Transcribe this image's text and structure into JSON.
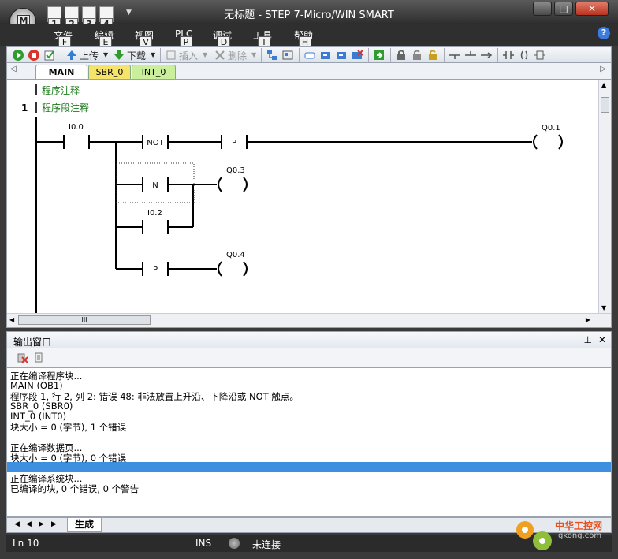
{
  "titlebar": {
    "title": "无标题 - STEP 7-Micro/WIN SMART",
    "app_key": "M",
    "quick_keys": [
      "1",
      "2",
      "3",
      "4"
    ],
    "caption_buttons": [
      "–",
      "□",
      "✕"
    ]
  },
  "menu": [
    {
      "label": "文件",
      "key": "F"
    },
    {
      "label": "编辑",
      "key": "E"
    },
    {
      "label": "视图",
      "key": "V"
    },
    {
      "label": "PLC",
      "key": "P"
    },
    {
      "label": "调试",
      "key": "D"
    },
    {
      "label": "工具",
      "key": "T"
    },
    {
      "label": "帮助",
      "key": "H"
    }
  ],
  "help_icon": "?",
  "toolbar": {
    "upload": "上传",
    "download": "下载",
    "insert": "插入",
    "delete": "删除"
  },
  "tabs": [
    "MAIN",
    "SBR_0",
    "INT_0"
  ],
  "editor": {
    "program_comment": "程序注释",
    "network_number": "1",
    "network_comment": "程序段注释",
    "contacts": {
      "i00": "I0.0",
      "not": "NOT",
      "p1": "P",
      "n": "N",
      "i02": "I0.2",
      "p2": "P"
    },
    "coils": {
      "q01": "Q0.1",
      "q03": "Q0.3",
      "q04": "Q0.4"
    },
    "hscroll_grip": "III"
  },
  "output": {
    "title": "输出窗口",
    "lines": [
      "正在编译程序块...",
      "MAIN (OB1)",
      "程序段 1, 行 2, 列 2: 错误 48: 非法放置上升沿、下降沿或 NOT 触点。",
      "SBR_0 (SBR0)",
      "INT_0 (INT0)",
      "块大小 = 0 (字节), 1 个错误",
      "",
      "正在编译数据页...",
      "块大小 = 0 (字节), 0 个错误",
      "",
      "正在编译系统块...",
      "已编译的块, 0 个错误, 0 个警告"
    ],
    "selected_line": 9,
    "tab": "生成",
    "pin": "⊥",
    "close": "✕"
  },
  "status": {
    "position": "Ln 10",
    "mode": "INS",
    "connection": "未连接"
  },
  "watermark": {
    "line1": "中华工控网",
    "line2": "gkong.com"
  },
  "colors": {
    "accent": "#3d8fe0",
    "comment_green": "#1b7a1b",
    "tab_sbr": "#f6e36a",
    "tab_int": "#c9ef9a"
  }
}
